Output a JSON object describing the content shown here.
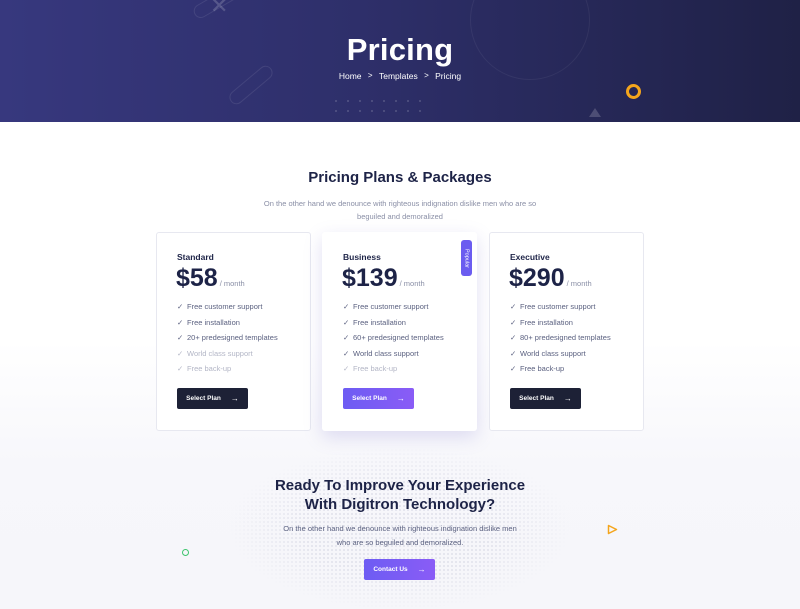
{
  "hero": {
    "title": "Pricing",
    "breadcrumb": [
      "Home",
      "Templates",
      "Pricing"
    ],
    "separator": ">"
  },
  "pricing": {
    "title": "Pricing Plans & Packages",
    "subtitle": "On the other hand we denounce with righteous indignation dislike men who are so beguiled and demoralized",
    "plans": [
      {
        "name": "Standard",
        "price": "$58",
        "period": "/ month",
        "featured": false,
        "badge": "",
        "features": [
          {
            "text": "Free customer support",
            "included": true
          },
          {
            "text": "Free installation",
            "included": true
          },
          {
            "text": "20+ predesigned templates",
            "included": true
          },
          {
            "text": "World class support",
            "included": false
          },
          {
            "text": "Free back-up",
            "included": false
          }
        ],
        "button": "Select Plan"
      },
      {
        "name": "Business",
        "price": "$139",
        "period": "/ month",
        "featured": true,
        "badge": "Popular",
        "features": [
          {
            "text": "Free customer support",
            "included": true
          },
          {
            "text": "Free installation",
            "included": true
          },
          {
            "text": "60+ predesigned templates",
            "included": true
          },
          {
            "text": "World class support",
            "included": true
          },
          {
            "text": "Free back-up",
            "included": false
          }
        ],
        "button": "Select Plan"
      },
      {
        "name": "Executive",
        "price": "$290",
        "period": "/ month",
        "featured": false,
        "badge": "",
        "features": [
          {
            "text": "Free customer support",
            "included": true
          },
          {
            "text": "Free installation",
            "included": true
          },
          {
            "text": "80+ predesigned templates",
            "included": true
          },
          {
            "text": "World class support",
            "included": true
          },
          {
            "text": "Free back-up",
            "included": true
          }
        ],
        "button": "Select Plan"
      }
    ],
    "check_icon": "✓",
    "button_arrow": "→"
  },
  "cta": {
    "title_line1": "Ready To Improve Your Experience",
    "title_line2": "With Digitron Technology?",
    "subtitle_line1": "On the other hand we denounce with righteous indignation dislike men",
    "subtitle_line2": "who are so beguiled and demoralized.",
    "button": "Contact Us",
    "button_arrow": "→"
  },
  "colors": {
    "hero_bg": "#37387e",
    "accent_purple": "#6d5cf3",
    "dark_button": "#1d2136",
    "heading": "#1d2347",
    "ring_orange": "#f4a51c",
    "green": "#3ec46d"
  }
}
